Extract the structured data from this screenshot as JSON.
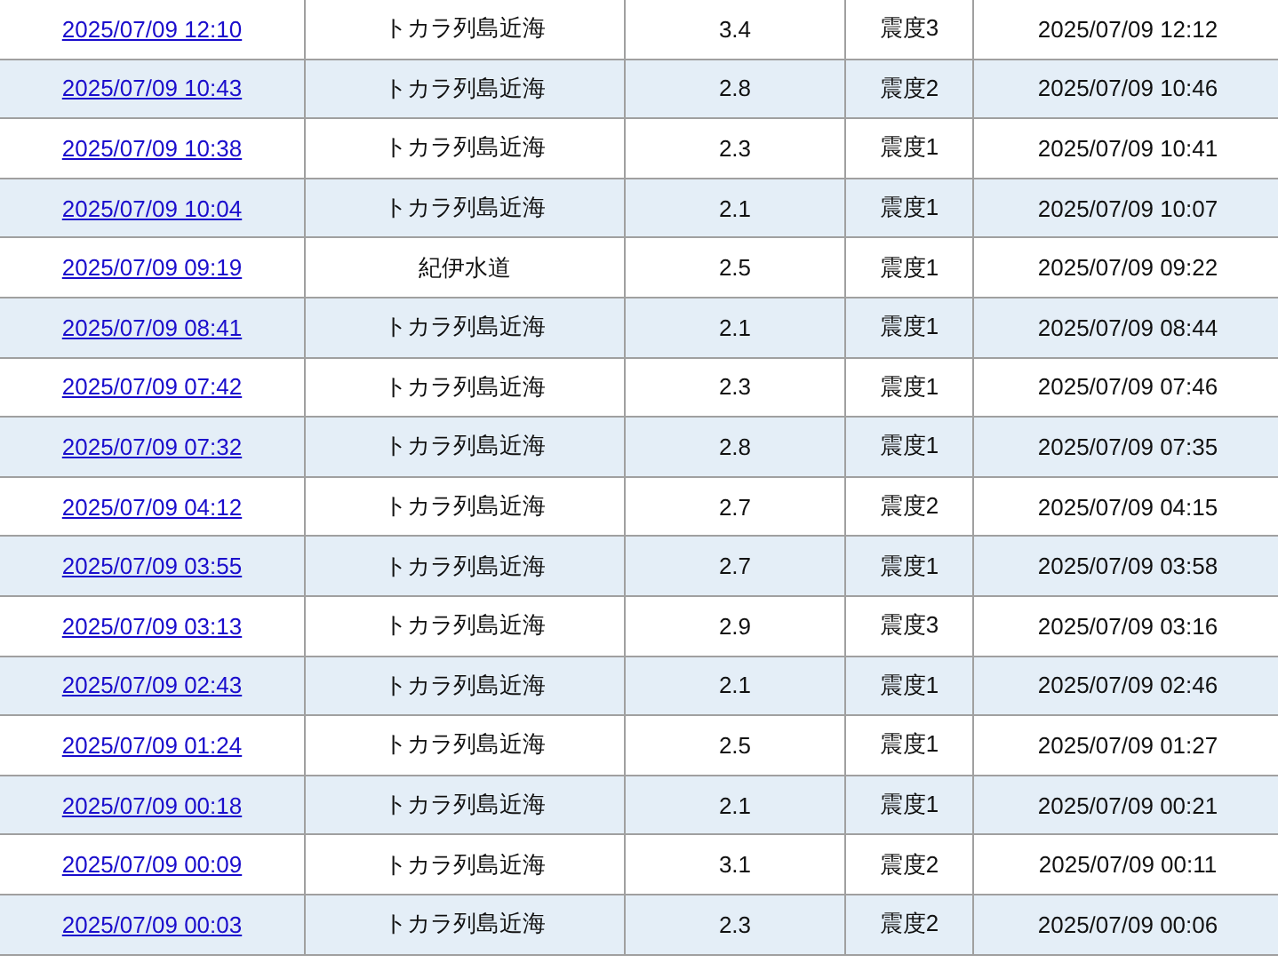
{
  "table": {
    "rows": [
      {
        "occurred": "2025/07/09 12:10",
        "region": "トカラ列島近海",
        "magnitude": "3.4",
        "intensity": "震度3",
        "announced": "2025/07/09 12:12"
      },
      {
        "occurred": "2025/07/09 10:43",
        "region": "トカラ列島近海",
        "magnitude": "2.8",
        "intensity": "震度2",
        "announced": "2025/07/09 10:46"
      },
      {
        "occurred": "2025/07/09 10:38",
        "region": "トカラ列島近海",
        "magnitude": "2.3",
        "intensity": "震度1",
        "announced": "2025/07/09 10:41"
      },
      {
        "occurred": "2025/07/09 10:04",
        "region": "トカラ列島近海",
        "magnitude": "2.1",
        "intensity": "震度1",
        "announced": "2025/07/09 10:07"
      },
      {
        "occurred": "2025/07/09 09:19",
        "region": "紀伊水道",
        "magnitude": "2.5",
        "intensity": "震度1",
        "announced": "2025/07/09 09:22"
      },
      {
        "occurred": "2025/07/09 08:41",
        "region": "トカラ列島近海",
        "magnitude": "2.1",
        "intensity": "震度1",
        "announced": "2025/07/09 08:44"
      },
      {
        "occurred": "2025/07/09 07:42",
        "region": "トカラ列島近海",
        "magnitude": "2.3",
        "intensity": "震度1",
        "announced": "2025/07/09 07:46"
      },
      {
        "occurred": "2025/07/09 07:32",
        "region": "トカラ列島近海",
        "magnitude": "2.8",
        "intensity": "震度1",
        "announced": "2025/07/09 07:35"
      },
      {
        "occurred": "2025/07/09 04:12",
        "region": "トカラ列島近海",
        "magnitude": "2.7",
        "intensity": "震度2",
        "announced": "2025/07/09 04:15"
      },
      {
        "occurred": "2025/07/09 03:55",
        "region": "トカラ列島近海",
        "magnitude": "2.7",
        "intensity": "震度1",
        "announced": "2025/07/09 03:58"
      },
      {
        "occurred": "2025/07/09 03:13",
        "region": "トカラ列島近海",
        "magnitude": "2.9",
        "intensity": "震度3",
        "announced": "2025/07/09 03:16"
      },
      {
        "occurred": "2025/07/09 02:43",
        "region": "トカラ列島近海",
        "magnitude": "2.1",
        "intensity": "震度1",
        "announced": "2025/07/09 02:46"
      },
      {
        "occurred": "2025/07/09 01:24",
        "region": "トカラ列島近海",
        "magnitude": "2.5",
        "intensity": "震度1",
        "announced": "2025/07/09 01:27"
      },
      {
        "occurred": "2025/07/09 00:18",
        "region": "トカラ列島近海",
        "magnitude": "2.1",
        "intensity": "震度1",
        "announced": "2025/07/09 00:21"
      },
      {
        "occurred": "2025/07/09 00:09",
        "region": "トカラ列島近海",
        "magnitude": "3.1",
        "intensity": "震度2",
        "announced": "2025/07/09 00:11"
      },
      {
        "occurred": "2025/07/09 00:03",
        "region": "トカラ列島近海",
        "magnitude": "2.3",
        "intensity": "震度2",
        "announced": "2025/07/09 00:06"
      }
    ]
  }
}
